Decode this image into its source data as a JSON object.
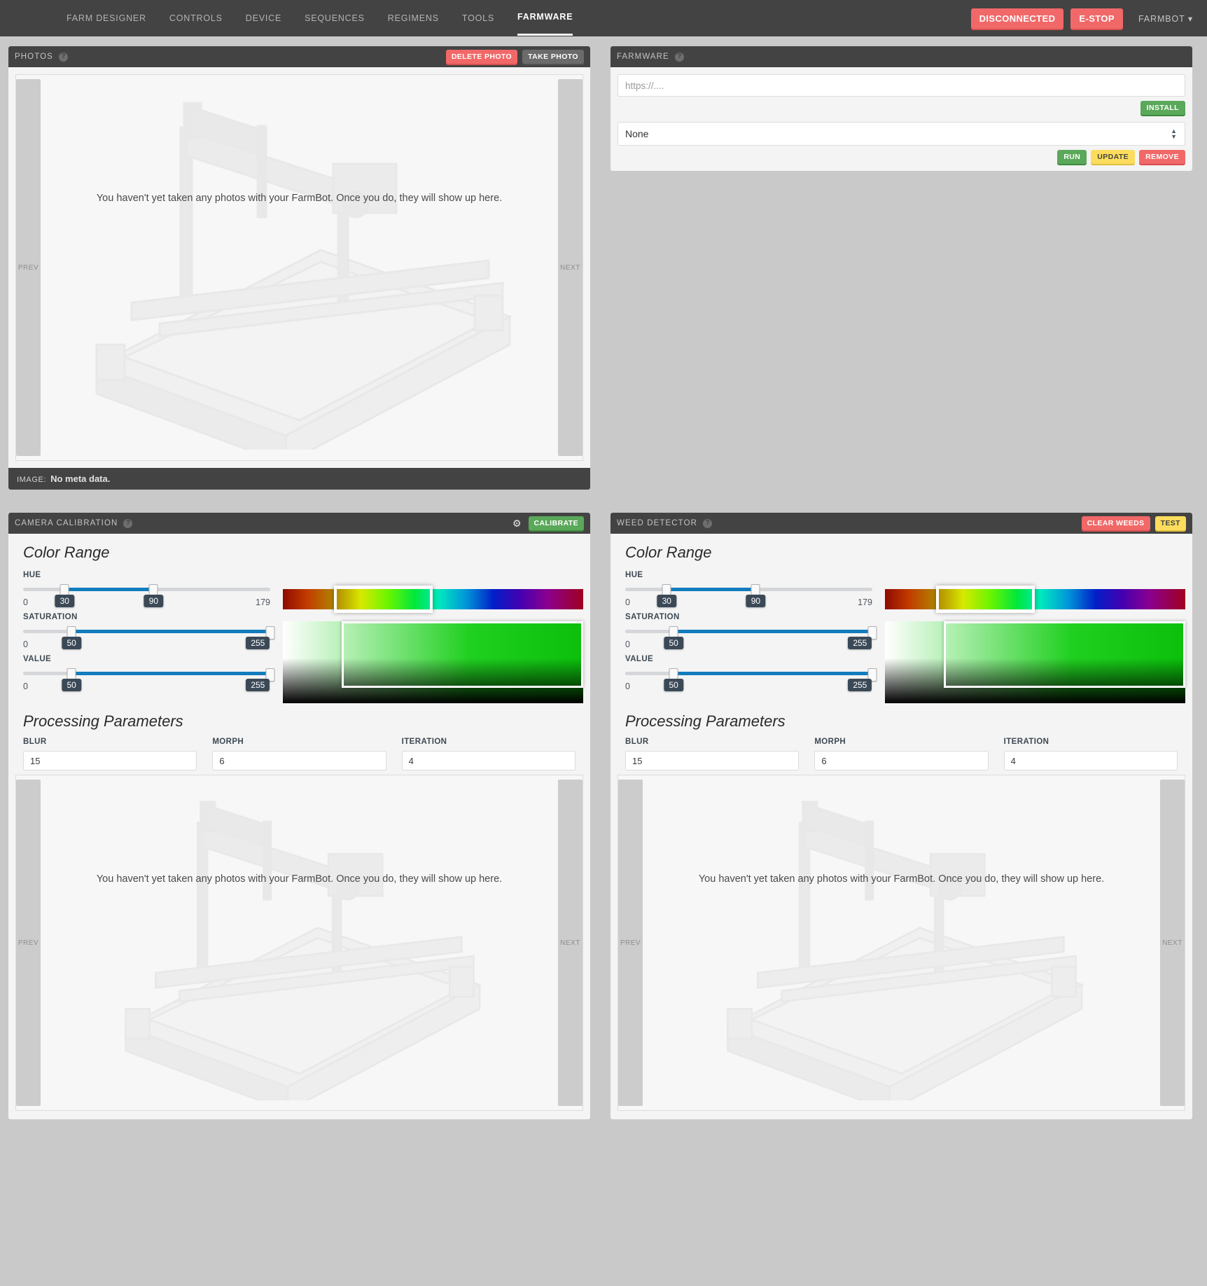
{
  "nav": {
    "links": [
      {
        "label": "FARM DESIGNER",
        "active": false
      },
      {
        "label": "CONTROLS",
        "active": false
      },
      {
        "label": "DEVICE",
        "active": false
      },
      {
        "label": "SEQUENCES",
        "active": false
      },
      {
        "label": "REGIMENS",
        "active": false
      },
      {
        "label": "TOOLS",
        "active": false
      },
      {
        "label": "FARMWARE",
        "active": true
      }
    ],
    "status_label": "DISCONNECTED",
    "estop_label": "E-STOP",
    "account_label": "FARMBOT ▾"
  },
  "photos": {
    "title": "PHOTOS",
    "help": "?",
    "delete_label": "DELETE PHOTO",
    "take_label": "TAKE PHOTO",
    "prev_label": "PREV",
    "next_label": "NEXT",
    "placeholder": "You haven't yet taken any photos with your FarmBot. Once you do, they will show up here.",
    "meta_label": "IMAGE:",
    "meta_value": "No meta data."
  },
  "farmware": {
    "title": "FARMWARE",
    "help": "?",
    "url_placeholder": "https://....",
    "url_value": "",
    "install_label": "INSTALL",
    "selected": "None",
    "run_label": "RUN",
    "update_label": "UPDATE",
    "remove_label": "REMOVE"
  },
  "camera_calibration": {
    "title": "CAMERA CALIBRATION",
    "help": "?",
    "gear_icon": "gear-icon",
    "calibrate_label": "CALIBRATE",
    "color_range_title": "Color Range",
    "processing_title": "Processing Parameters",
    "sliders": [
      {
        "name": "HUE",
        "min": 0,
        "max": 179,
        "lo": 30,
        "hi": 90
      },
      {
        "name": "SATURATION",
        "min": 0,
        "max": 255,
        "lo": 50,
        "hi": 255
      },
      {
        "name": "VALUE",
        "min": 0,
        "max": 255,
        "lo": 50,
        "hi": 255
      }
    ],
    "params": [
      {
        "label": "BLUR",
        "value": "15"
      },
      {
        "label": "MORPH",
        "value": "6"
      },
      {
        "label": "ITERATION",
        "value": "4"
      }
    ],
    "prev_label": "PREV",
    "next_label": "NEXT",
    "placeholder": "You haven't yet taken any photos with your FarmBot. Once you do, they will show up here."
  },
  "weed_detector": {
    "title": "WEED DETECTOR",
    "help": "?",
    "clear_label": "CLEAR WEEDS",
    "test_label": "TEST",
    "color_range_title": "Color Range",
    "processing_title": "Processing Parameters",
    "sliders": [
      {
        "name": "HUE",
        "min": 0,
        "max": 179,
        "lo": 30,
        "hi": 90
      },
      {
        "name": "SATURATION",
        "min": 0,
        "max": 255,
        "lo": 50,
        "hi": 255
      },
      {
        "name": "VALUE",
        "min": 0,
        "max": 255,
        "lo": 50,
        "hi": 255
      }
    ],
    "params": [
      {
        "label": "BLUR",
        "value": "15"
      },
      {
        "label": "MORPH",
        "value": "6"
      },
      {
        "label": "ITERATION",
        "value": "4"
      }
    ],
    "prev_label": "PREV",
    "next_label": "NEXT",
    "placeholder": "You haven't yet taken any photos with your FarmBot. Once you do, they will show up here."
  },
  "colors": {
    "navbar": "#434343",
    "panel_header": "#434343",
    "body_bg": "#c9c9c9",
    "widget_bg": "#f4f4f4",
    "danger": "#f16868",
    "success": "#5aa85a",
    "warning": "#fcdc5c",
    "slider_fill": "#137cbd",
    "bubble_bg": "#3b4957"
  }
}
